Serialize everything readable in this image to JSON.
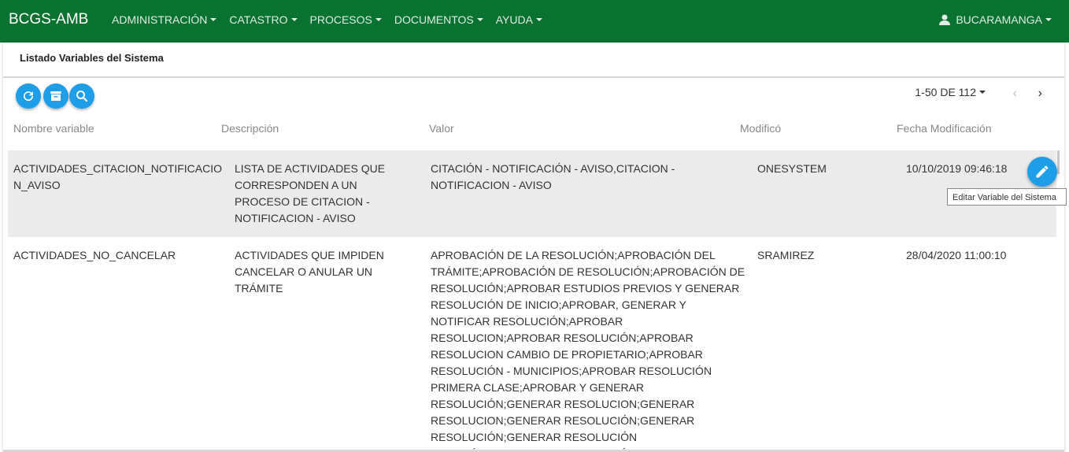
{
  "navbar": {
    "brand": "BCGS-AMB",
    "menus": [
      "ADMINISTRACIÓN",
      "CATASTRO",
      "PROCESOS",
      "DOCUMENTOS",
      "AYUDA"
    ],
    "user": "BUCARAMANGA",
    "bg_color": "#0a7230"
  },
  "card": {
    "title": "Listado Variables del Sistema"
  },
  "toolbar": {
    "refresh_icon": "refresh-icon",
    "archive_icon": "archive-icon",
    "search_icon": "search-icon",
    "accent": "#1e9ee8"
  },
  "pager": {
    "label": "1-50 DE 112",
    "prev": "‹",
    "next": "›"
  },
  "table": {
    "columns": [
      "Nombre variable",
      "Descripción",
      "Valor",
      "Modificó",
      "Fecha Modificación"
    ],
    "rows": [
      {
        "nombre": "ACTIVIDADES_CITACION_NOTIFICACION_AVISO",
        "descripcion": "LISTA DE ACTIVIDADES QUE CORRESPONDEN A UN PROCESO DE CITACION - NOTIFICACION - AVISO",
        "valor": "CITACIÓN - NOTIFICACIÓN - AVISO,CITACION - NOTIFICACION - AVISO",
        "modifico": "ONESYSTEM",
        "fecha": "10/10/2019 09:46:18"
      },
      {
        "nombre": "ACTIVIDADES_NO_CANCELAR",
        "descripcion": "ACTIVIDADES QUE IMPIDEN CANCELAR O ANULAR UN TRÁMITE",
        "valor": "APROBACIÓN DE LA RESOLUCIÓN;APROBACIÓN DEL TRÁMITE;APROBACIÓN DE RESOLUCIÓN;APROBACIÓN DE RESOLUCIÓN;APROBAR ESTUDIOS PREVIOS Y GENERAR RESOLUCIÓN DE INICIO;APROBAR, GENERAR Y NOTIFICAR RESOLUCIÓN;APROBAR RESOLUCION;APROBAR RESOLUCIÓN;APROBAR RESOLUCION CAMBIO DE PROPIETARIO;APROBAR RESOLUCIÓN - MUNICIPIOS;APROBAR RESOLUCIÓN PRIMERA CLASE;APROBAR Y GENERAR RESOLUCIÓN;GENERAR RESOLUCION;GENERAR RESOLUCION;GENERAR RESOLUCIÓN;GENERAR RESOLUCIÓN;GENERAR RESOLUCIÓN AUTOMÁTICA;GENERAR RESOLUCIÓN AUTOM",
        "modifico": "SRAMIREZ",
        "fecha": "28/04/2020 11:00:10"
      }
    ]
  },
  "row_actions": {
    "edit_icon": "pencil-icon",
    "tooltip": "Editar Variable del Sistema"
  }
}
